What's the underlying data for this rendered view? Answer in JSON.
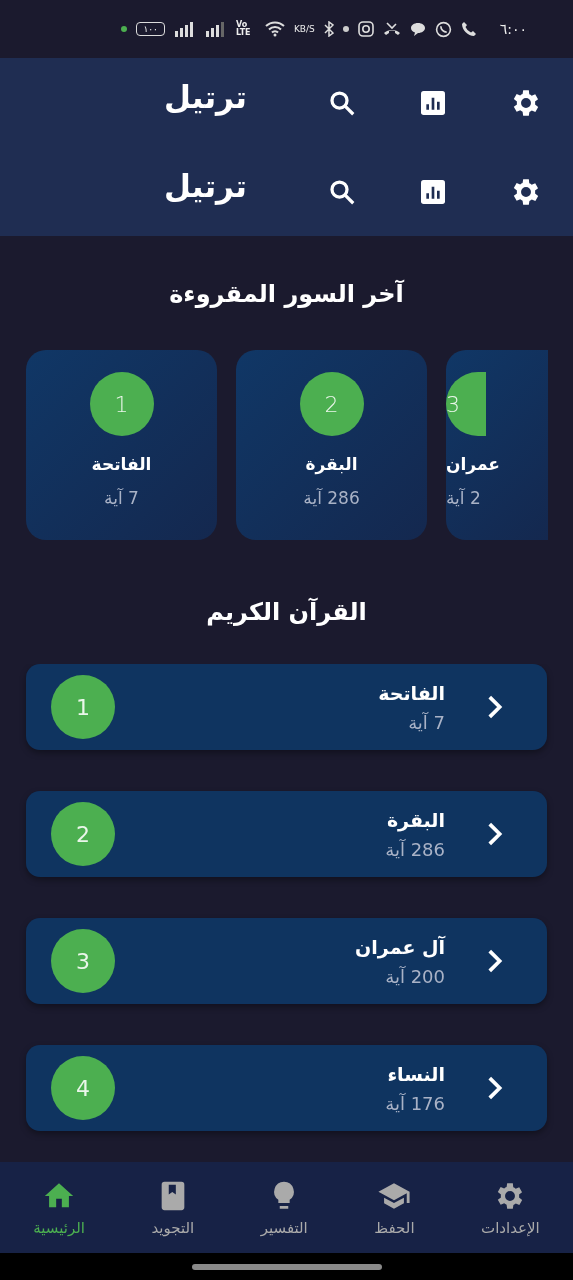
{
  "status_bar": {
    "time": "٦:٠٠",
    "network_speed": "KB/S",
    "volte": "Vo LTE",
    "battery": "١٠٠"
  },
  "app_bars": [
    {
      "title": "ترتيل"
    },
    {
      "title": "ترتيل"
    }
  ],
  "recent": {
    "title": "آخر السور المقروءة",
    "cards": [
      {
        "number": "3",
        "name": "عمران",
        "ayahs": "2 آية",
        "cut": true
      },
      {
        "number": "2",
        "name": "البقرة",
        "ayahs": "286 آية",
        "cut": false
      },
      {
        "number": "1",
        "name": "الفاتحة",
        "ayahs": "7 آية",
        "cut": false
      }
    ]
  },
  "quran": {
    "title": "القرآن الكريم",
    "surahs": [
      {
        "number": "1",
        "name": "الفاتحة",
        "ayahs": "7 آية"
      },
      {
        "number": "2",
        "name": "البقرة",
        "ayahs": "286 آية"
      },
      {
        "number": "3",
        "name": "آل عمران",
        "ayahs": "200 آية"
      },
      {
        "number": "4",
        "name": "النساء",
        "ayahs": "176 آية"
      }
    ]
  },
  "nav": [
    {
      "label": "الإعدادات",
      "kind": "settings",
      "selected": false
    },
    {
      "label": "الحفظ",
      "kind": "memorize",
      "selected": false
    },
    {
      "label": "التفسير",
      "kind": "tafsir",
      "selected": false
    },
    {
      "label": "التجويد",
      "kind": "tajweed",
      "selected": false
    },
    {
      "label": "الرئيسية",
      "kind": "home",
      "selected": true
    }
  ]
}
